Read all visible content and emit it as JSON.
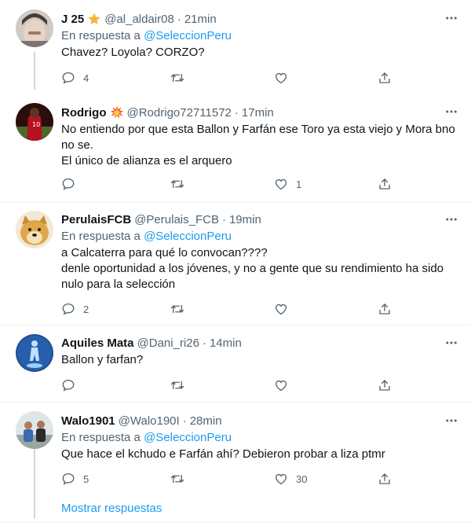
{
  "tweets": [
    {
      "name": "J 25",
      "badge": "star",
      "handle": "@al_aldair08",
      "time": "21min",
      "reply_prefix": "En respuesta a ",
      "reply_to": "@SeleccionPeru",
      "lines": [
        "Chavez? Loyola? CORZO?"
      ],
      "replies": "4",
      "retweets": "",
      "likes": ""
    },
    {
      "name": "Rodrigo",
      "badge": "explosion",
      "handle": "@Rodrigo72711572",
      "time": "17min",
      "reply_prefix": "",
      "reply_to": "",
      "lines": [
        "No entiendo por que esta Ballon y Farfán ese Toro ya esta viejo y Mora bno",
        "no se.",
        "El único de alianza es el arquero"
      ],
      "replies": "",
      "retweets": "",
      "likes": "1"
    },
    {
      "name": "PerulaisFCB",
      "badge": "",
      "handle": "@Perulais_FCB",
      "time": "19min",
      "reply_prefix": "En respuesta a ",
      "reply_to": "@SeleccionPeru",
      "lines": [
        "a Calcaterra para qué lo convocan????",
        "denle oportunidad a los jóvenes, y no a gente que su rendimiento ha sido",
        "nulo para la selección"
      ],
      "replies": "2",
      "retweets": "",
      "likes": ""
    },
    {
      "name": "Aquiles Mata",
      "badge": "",
      "handle": "@Dani_ri26",
      "time": "14min",
      "reply_prefix": "",
      "reply_to": "",
      "lines": [
        "Ballon y farfan?"
      ],
      "replies": "",
      "retweets": "",
      "likes": ""
    },
    {
      "name": "Walo1901",
      "badge": "",
      "handle": "@Walo190I",
      "time": "28min",
      "reply_prefix": "En respuesta a ",
      "reply_to": "@SeleccionPeru",
      "lines": [
        "Que hace el kchudo e Farfán ahí? Debieron probar a liza ptmr"
      ],
      "replies": "5",
      "retweets": "",
      "likes": "30"
    }
  ],
  "separator": "·",
  "show_replies": "Mostrar respuestas",
  "colors": {
    "link": "#1d9bf0",
    "secondary": "#536471",
    "text": "#0f1419",
    "divider": "#eff3f4",
    "thread_line": "#cfd9de"
  },
  "icons": {
    "reply": "reply-icon",
    "retweet": "retweet-icon",
    "like": "heart-icon",
    "share": "share-icon",
    "more": "more-icon"
  }
}
